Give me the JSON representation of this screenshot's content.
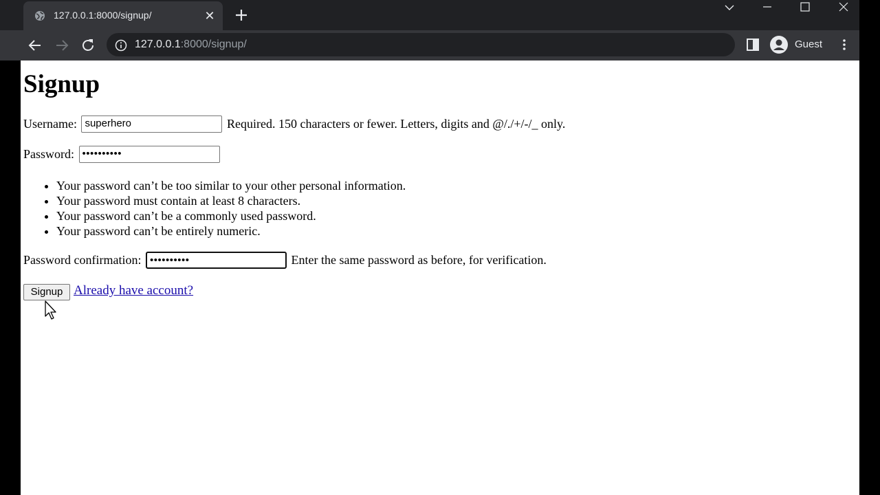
{
  "browser": {
    "tab": {
      "title": "127.0.0.1:8000/signup/",
      "close_glyph": "✕",
      "favicon": "globe-icon"
    },
    "new_tab_icon": "plus-icon",
    "window_controls": [
      "chevron-down-icon",
      "minimize-icon",
      "maximize-icon",
      "close-icon"
    ],
    "nav": [
      "back-arrow-icon",
      "forward-arrow-icon",
      "reload-icon"
    ],
    "address_bar": {
      "host": "127.0.0.1",
      "rest": ":8000/signup/",
      "icon": "info-icon"
    },
    "profile": {
      "name": "Guest",
      "icon": "avatar-icon"
    },
    "side_panel_icon": "side-panel-icon",
    "menu_icon": "kebab-menu-icon"
  },
  "page": {
    "heading": "Signup",
    "username": {
      "label": "Username:",
      "value": "superhero",
      "help": "Required. 150 characters or fewer. Letters, digits and @/./+/-/_ only."
    },
    "password": {
      "label": "Password:",
      "value": "••••••••••"
    },
    "password_rules": [
      "Your password can’t be too similar to your other personal information.",
      "Your password must contain at least 8 characters.",
      "Your password can’t be a commonly used password.",
      "Your password can’t be entirely numeric."
    ],
    "password_confirmation": {
      "label": "Password confirmation:",
      "value": "••••••••••",
      "help": "Enter the same password as before, for verification."
    },
    "submit_label": "Signup",
    "login_link": "Already have account?"
  },
  "colors": {
    "chrome_dark": "#202124",
    "chrome_toolbar": "#35363a",
    "chrome_text": "#e8eaed",
    "link": "#1a0dab"
  }
}
